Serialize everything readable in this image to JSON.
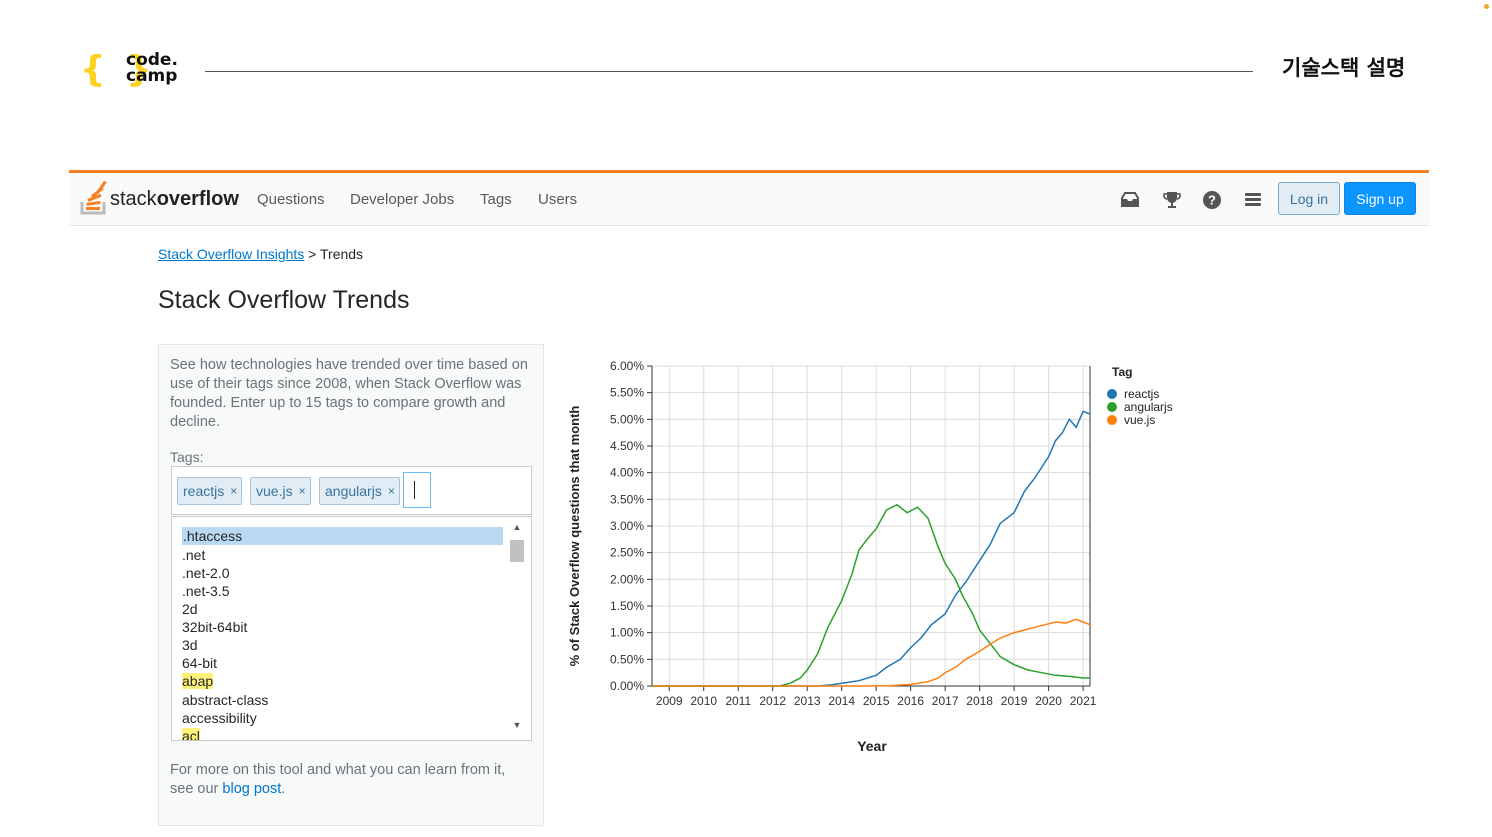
{
  "slide": {
    "logo_line1": "code.",
    "logo_line2": "camp",
    "title": "기술스택 설명"
  },
  "so_nav": {
    "logo_light": "stack",
    "logo_bold": "overflow",
    "links": [
      "Questions",
      "Developer Jobs",
      "Tags",
      "Users"
    ],
    "icons": [
      "inbox-icon",
      "trophy-icon",
      "help-icon",
      "site-switcher-icon"
    ],
    "login_label": "Log in",
    "signup_label": "Sign up"
  },
  "breadcrumb": {
    "link": "Stack Overflow Insights",
    "separator": ">",
    "current": "Trends"
  },
  "page_title": "Stack Overflow Trends",
  "panel": {
    "intro": "See how technologies have trended over time based on use of their tags since 2008, when Stack Overflow was founded. Enter up to 15 tags to compare growth and decline.",
    "tags_label": "Tags:",
    "selected_tags": [
      "reactjs",
      "vue.js",
      "angularjs"
    ],
    "remove_symbol": "×",
    "tag_options": [
      ".htaccess",
      ".net",
      ".net-2.0",
      ".net-3.5",
      "2d",
      "32bit-64bit",
      "3d",
      "64-bit",
      "abap",
      "abstract-class",
      "accessibility",
      "acl"
    ],
    "more_text_1": "For more on this tool and what you can learn from it, see our ",
    "more_link": "blog post",
    "more_text_2": "."
  },
  "colors": {
    "accent_orange": "#f48024",
    "signup_blue": "#0a95ff",
    "link_blue": "#0077cc",
    "reactjs": "#1f77b4",
    "angularjs": "#2ca02c",
    "vuejs": "#ff7f0e"
  },
  "chart_data": {
    "type": "line",
    "xlabel": "Year",
    "ylabel": "% of Stack Overflow questions that month",
    "xlim": [
      2008.5,
      2021.2
    ],
    "ylim": [
      0,
      6
    ],
    "x_ticks": [
      2009,
      2010,
      2011,
      2012,
      2013,
      2014,
      2015,
      2016,
      2017,
      2018,
      2019,
      2020,
      2021
    ],
    "y_ticks": [
      "0.00%",
      "0.50%",
      "1.00%",
      "1.50%",
      "2.00%",
      "2.50%",
      "3.00%",
      "3.50%",
      "4.00%",
      "4.50%",
      "5.00%",
      "5.50%",
      "6.00%"
    ],
    "grid": true,
    "legend_title": "Tag",
    "legend_position": "right",
    "series": [
      {
        "name": "reactjs",
        "color": "#1f77b4",
        "x": [
          2008.5,
          2013.3,
          2013.7,
          2014.0,
          2014.5,
          2015.0,
          2015.3,
          2015.7,
          2016.0,
          2016.3,
          2016.6,
          2017.0,
          2017.3,
          2017.6,
          2018.0,
          2018.3,
          2018.6,
          2019.0,
          2019.3,
          2019.6,
          2020.0,
          2020.2,
          2020.4,
          2020.6,
          2020.8,
          2021.0,
          2021.2
        ],
        "y": [
          0.0,
          0.0,
          0.02,
          0.05,
          0.1,
          0.2,
          0.35,
          0.5,
          0.72,
          0.9,
          1.15,
          1.35,
          1.7,
          1.95,
          2.35,
          2.65,
          3.05,
          3.25,
          3.65,
          3.9,
          4.3,
          4.6,
          4.75,
          5.0,
          4.85,
          5.15,
          5.1
        ]
      },
      {
        "name": "angularjs",
        "color": "#2ca02c",
        "x": [
          2008.5,
          2012.2,
          2012.5,
          2012.8,
          2013.0,
          2013.3,
          2013.6,
          2014.0,
          2014.3,
          2014.5,
          2014.8,
          2015.0,
          2015.3,
          2015.6,
          2015.9,
          2016.2,
          2016.5,
          2016.8,
          2017.0,
          2017.3,
          2017.5,
          2017.8,
          2018.0,
          2018.3,
          2018.6,
          2019.0,
          2019.4,
          2019.8,
          2020.2,
          2020.6,
          2021.0,
          2021.2
        ],
        "y": [
          0.0,
          0.0,
          0.05,
          0.15,
          0.3,
          0.6,
          1.1,
          1.6,
          2.1,
          2.55,
          2.8,
          2.95,
          3.3,
          3.4,
          3.25,
          3.35,
          3.15,
          2.6,
          2.3,
          2.0,
          1.7,
          1.35,
          1.05,
          0.8,
          0.55,
          0.4,
          0.3,
          0.25,
          0.2,
          0.18,
          0.15,
          0.15
        ]
      },
      {
        "name": "vue.js",
        "color": "#ff7f0e",
        "x": [
          2008.5,
          2014.8,
          2015.5,
          2016.0,
          2016.5,
          2016.8,
          2017.0,
          2017.3,
          2017.6,
          2018.0,
          2018.3,
          2018.6,
          2019.0,
          2019.3,
          2019.6,
          2019.9,
          2020.2,
          2020.5,
          2020.8,
          2021.0,
          2021.2
        ],
        "y": [
          0.0,
          0.0,
          0.01,
          0.03,
          0.08,
          0.15,
          0.25,
          0.35,
          0.5,
          0.65,
          0.78,
          0.9,
          1.0,
          1.05,
          1.1,
          1.15,
          1.2,
          1.18,
          1.25,
          1.2,
          1.15
        ]
      }
    ]
  }
}
